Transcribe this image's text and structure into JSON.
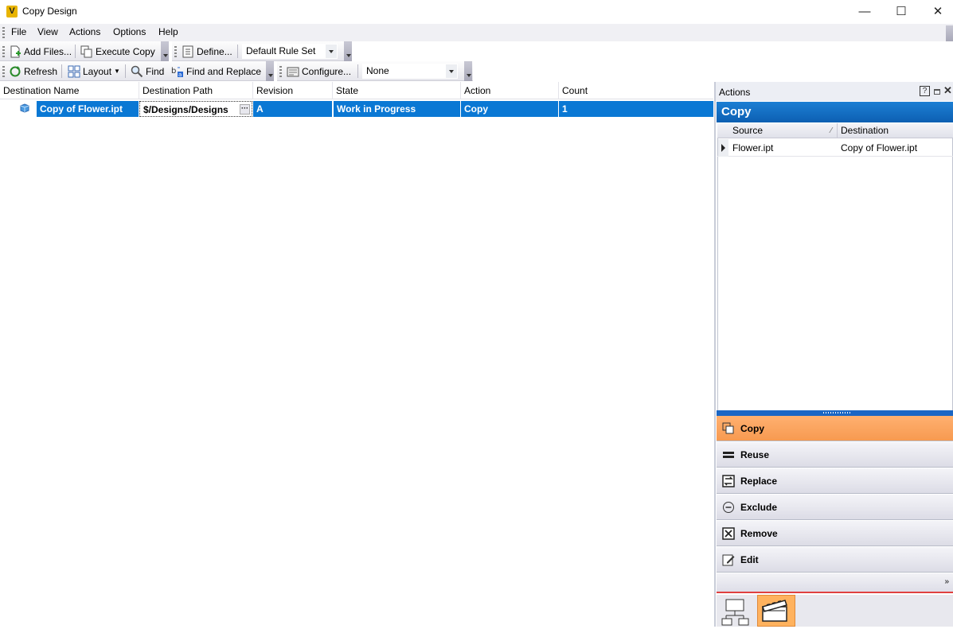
{
  "window": {
    "title": "Copy Design",
    "app_icon_letter": "V",
    "minimize": "—",
    "maximize": "☐",
    "close": "✕"
  },
  "menu": [
    "File",
    "View",
    "Actions",
    "Options",
    "Help"
  ],
  "toolbar1": {
    "add_files": "Add Files...",
    "execute_copy": "Execute Copy",
    "define": "Define...",
    "rule_set": "Default Rule Set"
  },
  "toolbar2": {
    "refresh": "Refresh",
    "layout": "Layout",
    "find": "Find",
    "find_replace": "Find and Replace",
    "configure": "Configure...",
    "filter": "None"
  },
  "grid": {
    "columns": [
      "Destination Name",
      "Destination Path",
      "Revision",
      "State",
      "Action",
      "Count"
    ],
    "rows": [
      {
        "name": "Copy of Flower.ipt",
        "path": "$/Designs/Designs",
        "revision": "A",
        "state": "Work in Progress",
        "action": "Copy",
        "count": "1"
      }
    ]
  },
  "panel": {
    "title": "Actions",
    "help": "?",
    "heading": "Copy",
    "columns": [
      "Source",
      "Destination"
    ],
    "rows": [
      {
        "source": "Flower.ipt",
        "destination": "Copy of Flower.ipt"
      }
    ],
    "actions": [
      "Copy",
      "Reuse",
      "Replace",
      "Exclude",
      "Remove",
      "Edit"
    ],
    "active_action": "Copy"
  },
  "colors": {
    "selection": "#0a78d4",
    "active_action": "#f79a50",
    "panel_heading": "#0d5fb2"
  }
}
